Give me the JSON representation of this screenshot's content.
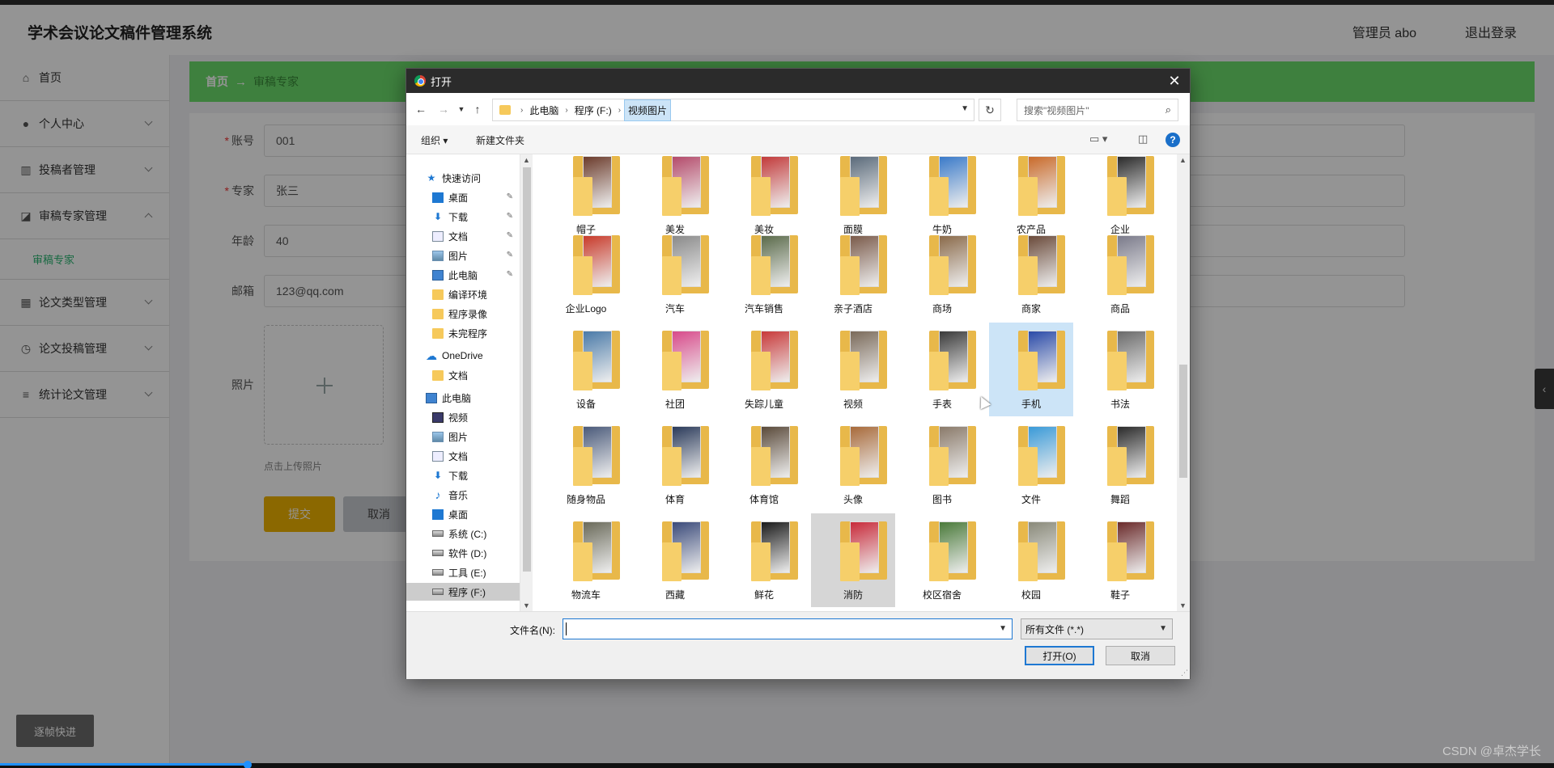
{
  "app": {
    "title": "学术会议论文稿件管理系统",
    "user_label": "管理员 abo",
    "logout_label": "退出登录"
  },
  "sidebar": {
    "items": [
      {
        "label": "首页",
        "icon": "home-icon",
        "expandable": false
      },
      {
        "label": "个人中心",
        "icon": "user-icon",
        "expandable": true
      },
      {
        "label": "投稿者管理",
        "icon": "bar-chart-icon",
        "expandable": true
      },
      {
        "label": "审稿专家管理",
        "icon": "line-chart-icon",
        "expandable": true,
        "expanded": true
      },
      {
        "label": "论文类型管理",
        "icon": "grid-icon",
        "expandable": true
      },
      {
        "label": "论文投稿管理",
        "icon": "clock-icon",
        "expandable": true
      },
      {
        "label": "统计论文管理",
        "icon": "list-icon",
        "expandable": true
      }
    ],
    "active_sub": "审稿专家",
    "fast_button": "逐帧快进"
  },
  "breadcrumb": {
    "home": "首页",
    "arrow": "→",
    "current": "审稿专家"
  },
  "form": {
    "account_label": "账号",
    "account_value": "001",
    "expert_label": "专家",
    "expert_value": "张三",
    "age_label": "年龄",
    "age_value": "40",
    "email_label": "邮箱",
    "email_value": "123@qq.com",
    "photo_label": "照片",
    "upload_hint": "点击上传照片",
    "submit": "提交",
    "cancel": "取消",
    "required_mark": "*"
  },
  "dialog": {
    "title": "打开",
    "path": [
      "此电脑",
      "程序 (F:)",
      "视频图片"
    ],
    "search_placeholder": "搜索\"视频图片\"",
    "organize": "组织",
    "new_folder": "新建文件夹",
    "nav_tree": [
      {
        "label": "快速访问",
        "icon": "star-icon",
        "indent": 1
      },
      {
        "label": "桌面",
        "icon": "desktop-icon",
        "indent": 2,
        "pinned": true
      },
      {
        "label": "下载",
        "icon": "download-icon",
        "indent": 2,
        "pinned": true
      },
      {
        "label": "文档",
        "icon": "document-icon",
        "indent": 2,
        "pinned": true
      },
      {
        "label": "图片",
        "icon": "picture-icon",
        "indent": 2,
        "pinned": true
      },
      {
        "label": "此电脑",
        "icon": "computer-icon",
        "indent": 2,
        "pinned": true
      },
      {
        "label": "编译环境",
        "icon": "folder-icon",
        "indent": 2
      },
      {
        "label": "程序录像",
        "icon": "folder-icon",
        "indent": 2
      },
      {
        "label": "未完程序",
        "icon": "folder-icon",
        "indent": 2
      },
      {
        "label": "OneDrive",
        "icon": "cloud-icon",
        "indent": 1
      },
      {
        "label": "文档",
        "icon": "folder-icon",
        "indent": 2
      },
      {
        "label": "此电脑",
        "icon": "computer-icon",
        "indent": 1
      },
      {
        "label": "视频",
        "icon": "video-icon",
        "indent": 2
      },
      {
        "label": "图片",
        "icon": "picture-icon",
        "indent": 2
      },
      {
        "label": "文档",
        "icon": "document-icon",
        "indent": 2
      },
      {
        "label": "下载",
        "icon": "download-icon",
        "indent": 2
      },
      {
        "label": "音乐",
        "icon": "music-icon",
        "indent": 2
      },
      {
        "label": "桌面",
        "icon": "desktop-icon",
        "indent": 2
      },
      {
        "label": "系统 (C:)",
        "icon": "drive-icon",
        "indent": 2
      },
      {
        "label": "软件 (D:)",
        "icon": "drive-icon",
        "indent": 2
      },
      {
        "label": "工具 (E:)",
        "icon": "drive-icon",
        "indent": 2
      },
      {
        "label": "程序 (F:)",
        "icon": "drive-icon",
        "indent": 2,
        "selected": true
      }
    ],
    "folders": [
      [
        "帽子",
        "美发",
        "美妆",
        "面膜",
        "牛奶",
        "农产品",
        "企业"
      ],
      [
        "企业Logo",
        "汽车",
        "汽车销售",
        "亲子酒店",
        "商场",
        "商家",
        "商品"
      ],
      [
        "设备",
        "社团",
        "失踪儿童",
        "视频",
        "手表",
        "手机",
        "书法"
      ],
      [
        "随身物品",
        "体育",
        "体育馆",
        "头像",
        "图书",
        "文件",
        "舞蹈"
      ],
      [
        "物流车",
        "西藏",
        "鲜花",
        "消防",
        "校区宿舍",
        "校园",
        "鞋子"
      ]
    ],
    "selected_folder": "手机",
    "gray_folder": "消防",
    "filename_label": "文件名(N):",
    "filename_value": "",
    "filetype": "所有文件 (*.*)",
    "open_button": "打开(O)",
    "cancel_button": "取消"
  },
  "watermark": "CSDN @卓杰学长",
  "colors": {
    "breadcrumb_bg": "#6bdc6b",
    "submit_bg": "#f0b400",
    "accent_green": "#2bb673",
    "selection_blue": "#cce4f7"
  }
}
